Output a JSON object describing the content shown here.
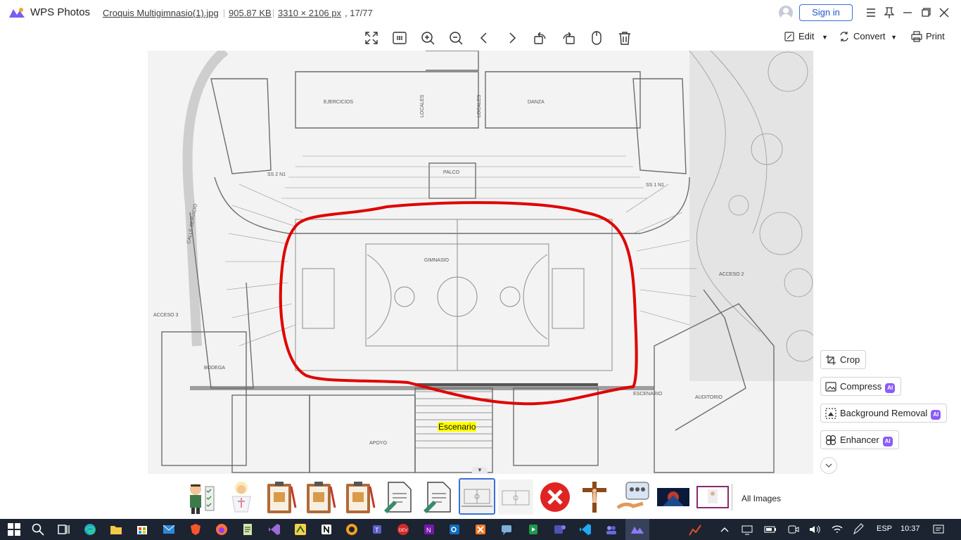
{
  "titlebar": {
    "app_name": "WPS Photos",
    "file_name": "Croquis Multigimnasio(1).jpg",
    "file_size": "905.87 KB",
    "dimensions": "3310 × 2106 px",
    "index": ", 17/77",
    "signin_label": "Sign in"
  },
  "toolbar": {
    "edit_label": "Edit",
    "convert_label": "Convert",
    "print_label": "Print"
  },
  "image": {
    "overlay_label": "Escenario",
    "plan_labels": {
      "ejercicios": "EJERCICIOS",
      "danza": "DANZA",
      "palco": "PALCO",
      "gimnasio": "GIMNASIO",
      "bodega": "BODEGA",
      "apoyo": "APOYO",
      "acceso2": "ACCESO 2",
      "acceso3": "ACCESO 3",
      "auditorio": "AUDITORIO",
      "escenario_plan": "ESCENARIO",
      "locales1": "LOCALES",
      "locales2": "LOCALES",
      "calle": "CALLE SERVICIO",
      "ss2": "SS 2 N1",
      "ss1": "SS 1 N1"
    }
  },
  "side_tools": {
    "crop": "Crop",
    "compress": "Compress",
    "background_removal": "Background Removal",
    "enhancer": "Enhancer",
    "ai_badge": "AI"
  },
  "filmstrip": {
    "all_images_label": "All Images",
    "active_index": 7
  },
  "taskbar": {
    "language": "ESP",
    "time": "10:37"
  },
  "colors": {
    "accent": "#3a6fd8",
    "ai_badge": "#8b5cf6",
    "highlight": "#ffff00",
    "circle_annotation": "#e00000",
    "taskbar_bg": "#1c2331"
  }
}
